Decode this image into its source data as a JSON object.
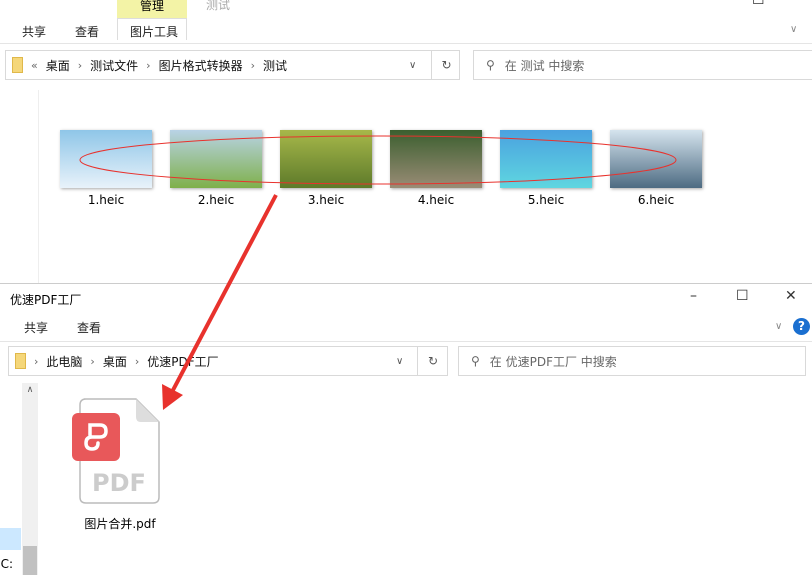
{
  "top_window": {
    "title": "测试",
    "context_tab": "管理",
    "tabs": [
      "共享",
      "查看",
      "图片工具"
    ],
    "breadcrumb": [
      "桌面",
      "测试文件",
      "图片格式转换器",
      "测试"
    ],
    "search_placeholder": "在 测试 中搜索",
    "files": [
      {
        "name": "1.heic",
        "colors": [
          "#8fc6e8",
          "#e8f2fa"
        ]
      },
      {
        "name": "2.heic",
        "colors": [
          "#b9d3e6",
          "#7fb04a"
        ]
      },
      {
        "name": "3.heic",
        "colors": [
          "#a7b84a",
          "#5d7a2a"
        ]
      },
      {
        "name": "4.heic",
        "colors": [
          "#3b5f2f",
          "#9a8c76"
        ]
      },
      {
        "name": "5.heic",
        "colors": [
          "#4aa2e0",
          "#5fd6e0"
        ]
      },
      {
        "name": "6.heic",
        "colors": [
          "#d5e4ee",
          "#4d6b82"
        ]
      }
    ]
  },
  "bottom_window": {
    "title": "优速PDF工厂",
    "tabs": [
      "共享",
      "查看"
    ],
    "breadcrumb": [
      "此电脑",
      "桌面",
      "优速PDF工厂"
    ],
    "search_placeholder": "在 优速PDF工厂 中搜索",
    "file": {
      "name": "图片合并.pdf",
      "icon_text": "PDF"
    },
    "nav_partial": "(C:"
  },
  "colors": {
    "annotation": "#e8322d",
    "pdf_red": "#e8585a",
    "context_tab": "#f3f3a6"
  }
}
